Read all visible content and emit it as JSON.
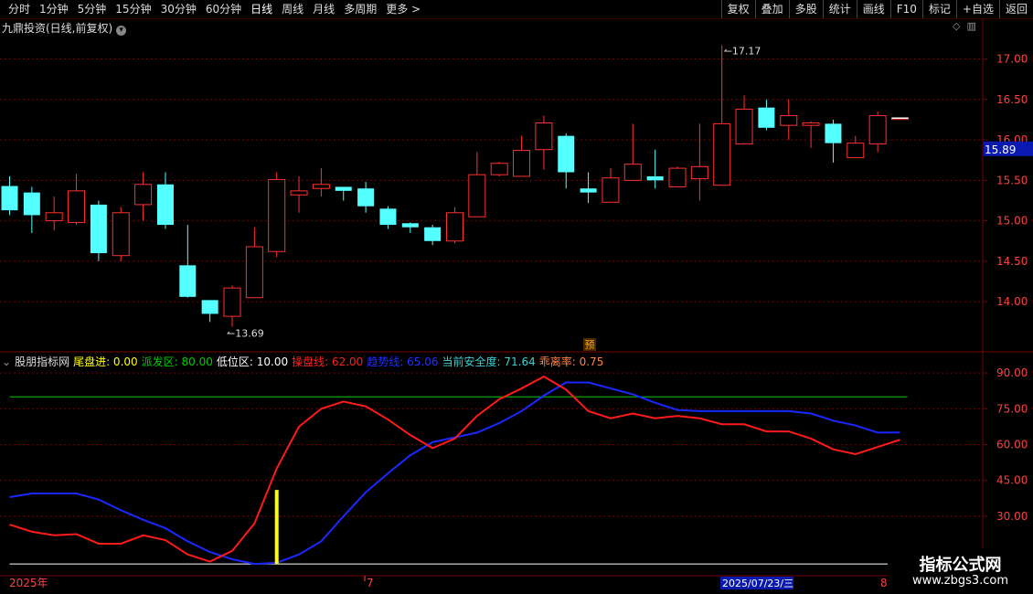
{
  "toolbar": {
    "periods": [
      "分时",
      "1分钟",
      "5分钟",
      "15分钟",
      "30分钟",
      "60分钟",
      "日线",
      "周线",
      "月线",
      "多周期",
      "更多 >"
    ],
    "active_period": "日线",
    "actions": [
      "复权",
      "叠加",
      "多股",
      "统计",
      "画线",
      "F10",
      "标记",
      "+自选",
      "返回"
    ]
  },
  "stock_title": "九鼎投资(日线,前复权)",
  "price_axis": [
    "17.00",
    "16.50",
    "16.00",
    "15.50",
    "15.00",
    "14.50",
    "14.00"
  ],
  "current_price_tag": "15.89",
  "high_label": "17.17",
  "low_label": "13.69",
  "pre_marker": "预",
  "indicator": {
    "name": "股朋指标网",
    "items": [
      {
        "label": "尾盘进:",
        "value": "0.00",
        "color": "#ffff00"
      },
      {
        "label": "派发区:",
        "value": "80.00",
        "color": "#00cc00"
      },
      {
        "label": "低位区:",
        "value": "10.00",
        "color": "#ffffff"
      },
      {
        "label": "操盘线:",
        "value": "62.00",
        "color": "#ff2020"
      },
      {
        "label": "趋势线:",
        "value": "65.06",
        "color": "#2030ff"
      },
      {
        "label": "当前安全度:",
        "value": "71.64",
        "color": "#3ad0d0"
      },
      {
        "label": "乖离率:",
        "value": "0.75",
        "color": "#ff8040"
      }
    ],
    "axis": [
      "90.00",
      "75.00",
      "60.00",
      "45.00",
      "30.00"
    ]
  },
  "date_axis": {
    "start": "2025年",
    "mid": "7",
    "cursor": "2025/07/23/三",
    "end": "8"
  },
  "watermark": {
    "line1": "指标公式网",
    "line2": "www.zbgs3.com"
  },
  "colors": {
    "up": "#ff3030",
    "down": "#54ffff",
    "grid": "#7a0000",
    "ma": "#ffffff"
  },
  "chart_data": {
    "type": "candlestick",
    "ylim": [
      13.55,
      17.3
    ],
    "candles": [
      {
        "o": 15.43,
        "h": 15.55,
        "l": 15.07,
        "c": 15.13
      },
      {
        "o": 15.35,
        "h": 15.42,
        "l": 14.85,
        "c": 15.07
      },
      {
        "o": 15.0,
        "h": 15.3,
        "l": 14.88,
        "c": 15.1
      },
      {
        "o": 14.98,
        "h": 15.58,
        "l": 14.95,
        "c": 15.37
      },
      {
        "o": 15.2,
        "h": 15.25,
        "l": 14.5,
        "c": 14.6
      },
      {
        "o": 14.57,
        "h": 15.17,
        "l": 14.5,
        "c": 15.1
      },
      {
        "o": 15.2,
        "h": 15.6,
        "l": 15.0,
        "c": 15.45
      },
      {
        "o": 15.45,
        "h": 15.6,
        "l": 14.9,
        "c": 14.95
      },
      {
        "o": 14.45,
        "h": 14.95,
        "l": 14.05,
        "c": 14.06
      },
      {
        "o": 14.02,
        "h": 14.02,
        "l": 13.75,
        "c": 13.85
      },
      {
        "o": 13.82,
        "h": 14.2,
        "l": 13.69,
        "c": 14.17
      },
      {
        "o": 14.05,
        "h": 14.92,
        "l": 14.05,
        "c": 14.68
      },
      {
        "o": 14.62,
        "h": 15.6,
        "l": 14.55,
        "c": 15.51
      },
      {
        "o": 15.32,
        "h": 15.55,
        "l": 15.1,
        "c": 15.37
      },
      {
        "o": 15.4,
        "h": 15.65,
        "l": 15.3,
        "c": 15.45
      },
      {
        "o": 15.42,
        "h": 15.42,
        "l": 15.25,
        "c": 15.37
      },
      {
        "o": 15.4,
        "h": 15.48,
        "l": 15.1,
        "c": 15.18
      },
      {
        "o": 15.15,
        "h": 15.18,
        "l": 14.9,
        "c": 14.95
      },
      {
        "o": 14.97,
        "h": 14.98,
        "l": 14.85,
        "c": 14.92
      },
      {
        "o": 14.92,
        "h": 14.95,
        "l": 14.7,
        "c": 14.75
      },
      {
        "o": 14.75,
        "h": 15.17,
        "l": 14.72,
        "c": 15.1
      },
      {
        "o": 15.05,
        "h": 15.85,
        "l": 15.05,
        "c": 15.57
      },
      {
        "o": 15.57,
        "h": 15.73,
        "l": 15.55,
        "c": 15.71
      },
      {
        "o": 15.55,
        "h": 16.05,
        "l": 15.55,
        "c": 15.87
      },
      {
        "o": 15.88,
        "h": 16.3,
        "l": 15.63,
        "c": 16.21
      },
      {
        "o": 16.05,
        "h": 16.08,
        "l": 15.4,
        "c": 15.6
      },
      {
        "o": 15.4,
        "h": 15.6,
        "l": 15.22,
        "c": 15.35
      },
      {
        "o": 15.23,
        "h": 15.65,
        "l": 15.23,
        "c": 15.53
      },
      {
        "o": 15.5,
        "h": 16.2,
        "l": 15.5,
        "c": 15.7
      },
      {
        "o": 15.55,
        "h": 15.88,
        "l": 15.4,
        "c": 15.5
      },
      {
        "o": 15.42,
        "h": 15.67,
        "l": 15.42,
        "c": 15.65
      },
      {
        "o": 15.52,
        "h": 16.2,
        "l": 15.25,
        "c": 15.67
      },
      {
        "o": 15.44,
        "h": 17.17,
        "l": 15.44,
        "c": 16.2
      },
      {
        "o": 15.95,
        "h": 16.55,
        "l": 15.95,
        "c": 16.38
      },
      {
        "o": 16.4,
        "h": 16.5,
        "l": 16.12,
        "c": 16.15
      },
      {
        "o": 16.18,
        "h": 16.5,
        "l": 16.0,
        "c": 16.3
      },
      {
        "o": 16.18,
        "h": 16.23,
        "l": 15.9,
        "c": 16.21
      },
      {
        "o": 16.2,
        "h": 16.25,
        "l": 15.72,
        "c": 15.96
      },
      {
        "o": 15.78,
        "h": 16.05,
        "l": 15.78,
        "c": 15.96
      },
      {
        "o": 15.95,
        "h": 16.35,
        "l": 15.85,
        "c": 16.3
      },
      {
        "o": 16.27,
        "h": 16.27,
        "l": 16.27,
        "c": 16.27
      }
    ],
    "indicator_ylim": [
      7,
      95
    ],
    "operate_line": [
      26.5,
      23.5,
      22.0,
      22.5,
      18.5,
      18.5,
      22.0,
      20.0,
      14.0,
      11.0,
      15.5,
      27.0,
      50.0,
      67.5,
      75.0,
      78.0,
      76.0,
      70.5,
      64.0,
      58.5,
      62.5,
      72.0,
      79.0,
      83.5,
      88.5,
      83.0,
      74.0,
      71.0,
      73.0,
      71.0,
      72.0,
      71.0,
      68.5,
      68.5,
      65.5,
      65.5,
      62.5,
      58.0,
      56.0,
      59.0,
      62.0
    ],
    "trend_line": [
      38.0,
      39.5,
      39.5,
      39.5,
      37.0,
      32.5,
      28.5,
      25.0,
      19.5,
      15.0,
      12.0,
      10.0,
      10.5,
      14.0,
      19.5,
      30.0,
      40.0,
      48.0,
      55.5,
      61.0,
      63.0,
      65.0,
      69.0,
      74.0,
      80.5,
      86.0,
      86.0,
      83.5,
      81.0,
      77.5,
      74.5,
      74.0,
      74.0,
      74.0,
      74.0,
      74.0,
      73.0,
      70.0,
      68.0,
      65.0,
      65.06
    ],
    "distribution_level": 80,
    "low_level": 10,
    "tail_signal_index": 12
  }
}
